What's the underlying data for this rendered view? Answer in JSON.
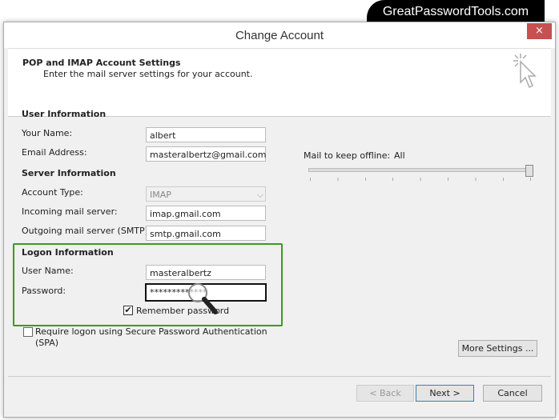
{
  "watermark": "GreatPasswordTools.com",
  "window": {
    "title": "Change Account",
    "close_label": "×"
  },
  "header": {
    "title": "POP and IMAP Account Settings",
    "subtitle": "Enter the mail server settings for your account."
  },
  "user_info": {
    "heading": "User Information",
    "name_label": "Your Name:",
    "name_value": "albert",
    "email_label": "Email Address:",
    "email_value": "masteralbertz@gmail.com"
  },
  "server_info": {
    "heading": "Server Information",
    "account_type_label": "Account Type:",
    "account_type_value": "IMAP",
    "incoming_label": "Incoming mail server:",
    "incoming_value": "imap.gmail.com",
    "outgoing_label": "Outgoing mail server (SMTP):",
    "outgoing_value": "smtp.gmail.com"
  },
  "logon_info": {
    "heading": "Logon Information",
    "user_label": "User Name:",
    "user_value": "masteralbertz",
    "password_label": "Password:",
    "password_value": "*************",
    "remember_label": "Remember password",
    "remember_checked": true,
    "highlight_color": "#3c9a1e"
  },
  "spa": {
    "label": "Require logon using Secure Password Authentication (SPA)",
    "checked": false
  },
  "offline": {
    "label": "Mail to keep offline:",
    "value": "All",
    "slider_fraction": 1.0
  },
  "buttons": {
    "more_settings": "More Settings ...",
    "back": "< Back",
    "next": "Next >",
    "cancel": "Cancel"
  }
}
